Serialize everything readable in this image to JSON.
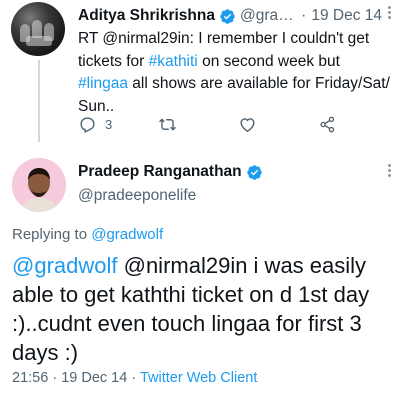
{
  "parent_tweet": {
    "author_name": "Aditya Shrikrishna",
    "handle": "@grad...",
    "separator": "·",
    "date": "19 Dec 14",
    "text_segments": [
      {
        "text": "RT @nirmal29in: I remember I couldn't get tickets for ",
        "kind": "text"
      },
      {
        "text": "#kathiti",
        "kind": "hashtag"
      },
      {
        "text": " on second week but ",
        "kind": "text"
      },
      {
        "text": "#lingaa",
        "kind": "hashtag"
      },
      {
        "text": " all shows are available for Friday/Sat/ Sun..",
        "kind": "text"
      }
    ],
    "actions": {
      "reply_icon": "reply-icon",
      "reply_count": "3",
      "retweet_icon": "retweet-icon",
      "like_icon": "heart-icon",
      "share_icon": "share-icon"
    }
  },
  "main_tweet": {
    "author_name": "Pradeep Ranganathan",
    "handle": "@pradeeponelife",
    "replying_prefix": "Replying to",
    "replying_to": "@gradwolf",
    "text_segments": [
      {
        "text": "@gradwolf",
        "kind": "mention"
      },
      {
        "text": " @nirmal29in i was easily able to get kaththi ticket on d 1st day :)..cudnt even touch lingaa for first 3 days :)",
        "kind": "text"
      }
    ],
    "time": "21:56",
    "date": "19 Dec 14",
    "separator": "·",
    "client": "Twitter Web Client"
  },
  "colors": {
    "accent": "#1d9bf0",
    "secondary_text": "#536471",
    "primary_text": "#0f1419",
    "thread_line": "#cfd9de"
  }
}
